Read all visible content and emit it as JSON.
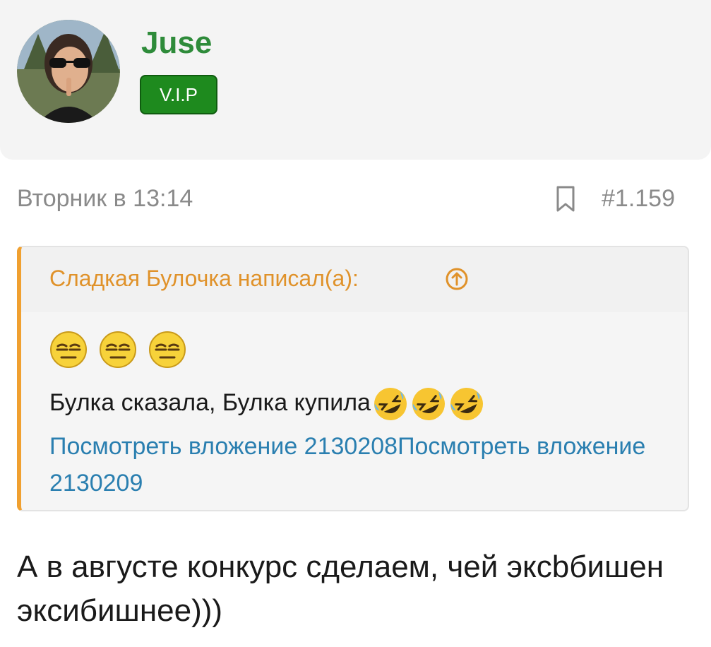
{
  "author": {
    "name": "Juse",
    "badge": "V.I.P"
  },
  "post": {
    "date": "Вторник в 13:14",
    "number": "#1.159",
    "text": "А в августе конкурс сделаем, чей эксbбишен эксибишнее)))"
  },
  "quote": {
    "author": "Сладкая Булочка написал(а):",
    "smiles": [
      "smile-relieved-icon",
      "smile-relieved-icon",
      "smile-relieved-icon"
    ],
    "text": "Булка сказала, Булка купила",
    "laugh_icons": [
      "rofl-icon",
      "rofl-icon",
      "rofl-icon"
    ],
    "attachment_1": "Посмотреть вложение 2130208",
    "attachment_2": "Посмотреть вложение 2130209"
  },
  "colors": {
    "name": "#2e8b3a",
    "badge": "#1e8a1e",
    "quote_accent": "#f0a030",
    "link": "#2a7fb0"
  }
}
